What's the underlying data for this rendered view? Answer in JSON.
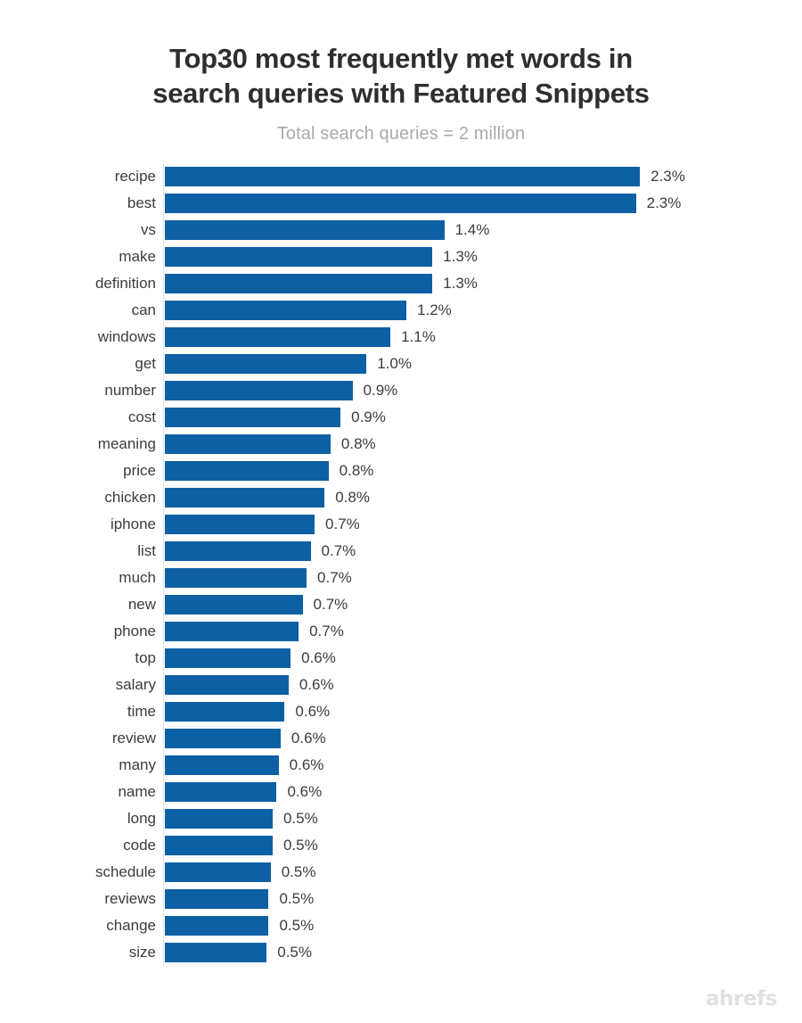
{
  "chart_data": {
    "type": "bar",
    "orientation": "horizontal",
    "title": "Top30 most frequently met words in search queries with Featured Snippets",
    "title_lines": [
      "Top30 most frequently met words in",
      "search queries with Featured Snippets"
    ],
    "subtitle": "Total search queries = 2 million",
    "xlabel": "",
    "ylabel": "",
    "grid": false,
    "legend": null,
    "xlim": [
      0,
      2.6
    ],
    "value_suffix": "%",
    "bar_color": "#0e60a4",
    "label_color": "#3c3c3c",
    "subtitle_color": "#aaaaaa",
    "categories": [
      "recipe",
      "best",
      "vs",
      "make",
      "definition",
      "can",
      "windows",
      "get",
      "number",
      "cost",
      "meaning",
      "price",
      "chicken",
      "iphone",
      "list",
      "much",
      "new",
      "phone",
      "top",
      "salary",
      "time",
      "review",
      "many",
      "name",
      "long",
      "code",
      "schedule",
      "reviews",
      "change",
      "size"
    ],
    "values": [
      2.38,
      2.36,
      1.4,
      1.34,
      1.34,
      1.21,
      1.13,
      1.01,
      0.94,
      0.88,
      0.83,
      0.82,
      0.8,
      0.75,
      0.73,
      0.71,
      0.69,
      0.67,
      0.63,
      0.62,
      0.6,
      0.58,
      0.57,
      0.56,
      0.54,
      0.54,
      0.53,
      0.52,
      0.52,
      0.51
    ],
    "labels": [
      "2.3%",
      "2.3%",
      "1.4%",
      "1.3%",
      "1.3%",
      "1.2%",
      "1.1%",
      "1.0%",
      "0.9%",
      "0.9%",
      "0.8%",
      "0.8%",
      "0.8%",
      "0.7%",
      "0.7%",
      "0.7%",
      "0.7%",
      "0.7%",
      "0.6%",
      "0.6%",
      "0.6%",
      "0.6%",
      "0.6%",
      "0.6%",
      "0.5%",
      "0.5%",
      "0.5%",
      "0.5%",
      "0.5%",
      "0.5%"
    ]
  },
  "footer": {
    "brand": "ahrefs"
  }
}
